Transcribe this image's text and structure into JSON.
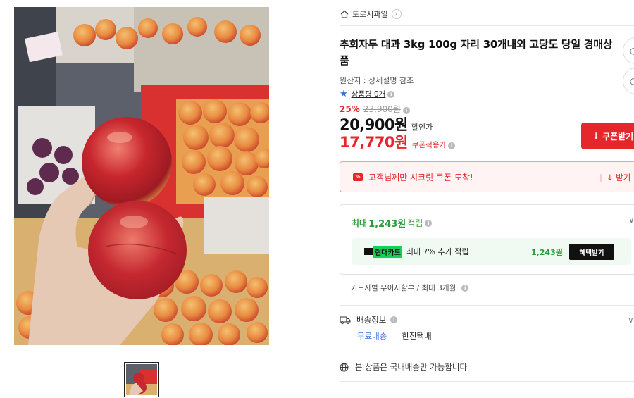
{
  "store": {
    "name": "도로시과일",
    "icon": "home-icon"
  },
  "product": {
    "title": "추희자두 대과 3kg 100g 자리 30개내외 고당도 당일 경매상품",
    "origin": "원산지 : 상세설명 참조",
    "review": "상품평 0개"
  },
  "price": {
    "discount_pct": "25%",
    "original": "23,900원",
    "sale": "20,900원",
    "sale_label": "할인가",
    "coupon": "17,770원",
    "coupon_label": "쿠폰적용가"
  },
  "buttons": {
    "coupon_download": "쿠폰받기"
  },
  "banner": {
    "tag": "%",
    "text": "고객님께만 시크릿 쿠폰 도착!",
    "download": "받기"
  },
  "points": {
    "prefix": "최대",
    "amount": "1,243원",
    "suffix": "적립",
    "card_name": "현대카드",
    "card_text": "최대 7% 추가 적립",
    "card_amount": "1,243원",
    "card_button": "혜택받기"
  },
  "installment": "카드사별 무이자할부 / 최대 3개월",
  "shipping": {
    "title": "배송정보",
    "fee": "무료배송",
    "courier": "한진택배",
    "notice": "본 상품은 국내배송만 가능합니다"
  },
  "colors": {
    "accent": "#e5262b",
    "points": "#2a9d3a",
    "link": "#2f6fe0",
    "card": "#16d05b"
  }
}
